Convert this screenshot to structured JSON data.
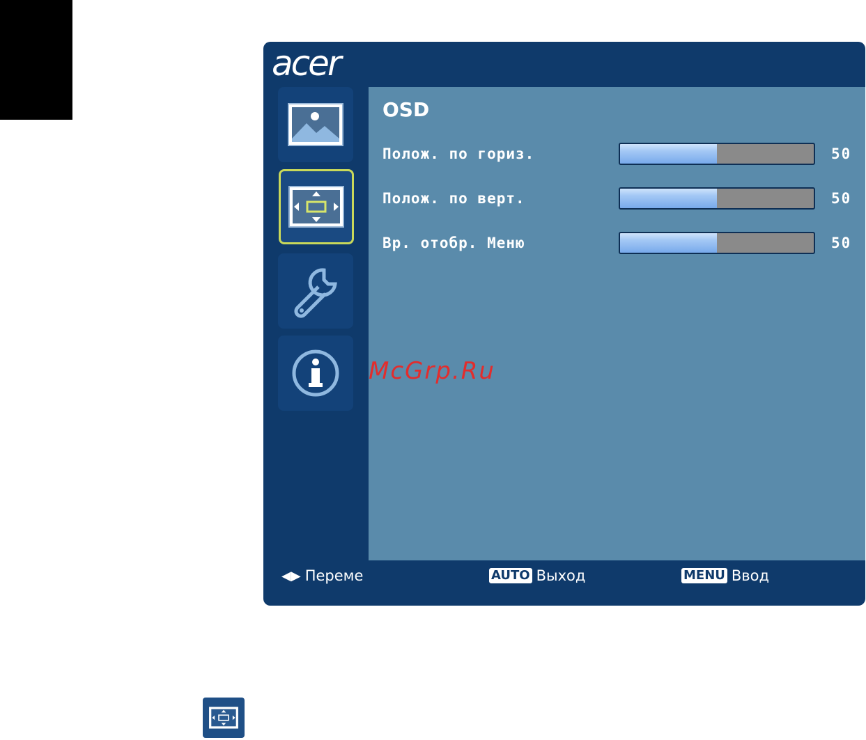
{
  "brand": {
    "logo_text": "acer"
  },
  "sidebar": {
    "items": [
      {
        "name": "picture",
        "icon": "picture-icon",
        "active": false
      },
      {
        "name": "osd",
        "icon": "osd-position-icon",
        "active": true
      },
      {
        "name": "settings",
        "icon": "wrench-icon",
        "active": false
      },
      {
        "name": "information",
        "icon": "info-icon",
        "active": false
      }
    ]
  },
  "panel": {
    "title": "OSD",
    "rows": [
      {
        "label": "Полож. по гориз.",
        "value": "50",
        "level": 0.5
      },
      {
        "label": "Полож. по верт.",
        "value": "50",
        "level": 0.5
      },
      {
        "label": "Вр. отобр. Меню",
        "value": "50",
        "level": 0.5
      }
    ]
  },
  "footer": {
    "move_label": "Переме",
    "auto_key": "AUTO",
    "exit_label": "Выход",
    "menu_key": "MENU",
    "enter_label": "Ввод"
  },
  "watermark": "McGrp.Ru",
  "colors": {
    "frame": "#0f3a6b",
    "content_bg": "#5a8bab",
    "active_border": "#c9d95a",
    "bar_fill": "#8fbaf0",
    "bar_empty": "#8a8a8a"
  }
}
